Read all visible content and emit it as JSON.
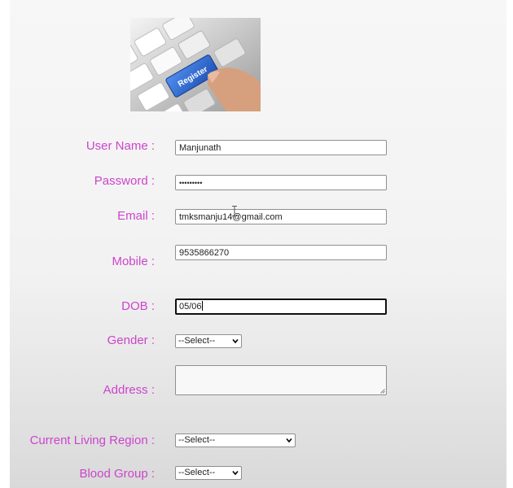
{
  "banner": {
    "key_label": "Register"
  },
  "form": {
    "user_name": {
      "label": "User Name :",
      "value": "Manjunath"
    },
    "password": {
      "label": "Password :",
      "value": "•••••••••"
    },
    "email": {
      "label": "Email :",
      "value": "tmksmanju14@gmail.com"
    },
    "mobile": {
      "label": "Mobile :",
      "value": "9535866270"
    },
    "dob": {
      "label": "DOB :",
      "value": "05/06"
    },
    "gender": {
      "label": "Gender :",
      "selected": "--Select--"
    },
    "address": {
      "label": "Address :",
      "value": ""
    },
    "region": {
      "label": "Current Living Region :",
      "selected": "--Select--"
    },
    "blood_group": {
      "label": "Blood Group :",
      "selected": "--Select--"
    }
  },
  "colors": {
    "label": "#cc44cc",
    "key_blue": "#2f6fd8"
  }
}
